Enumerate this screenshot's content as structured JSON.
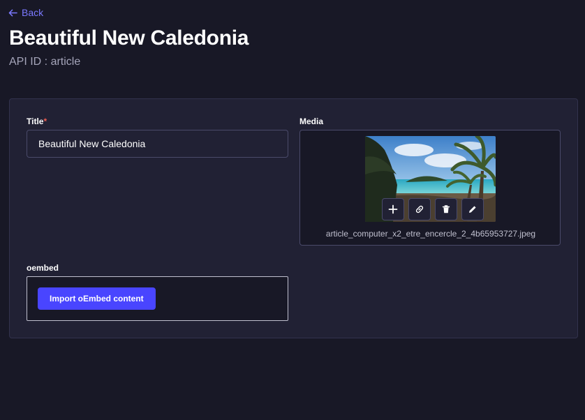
{
  "header": {
    "back_label": "Back",
    "title": "Beautiful New Caledonia",
    "subtitle": "API ID : article"
  },
  "form": {
    "title_field": {
      "label": "Title",
      "required_mark": "*",
      "value": "Beautiful New Caledonia"
    },
    "media_field": {
      "label": "Media",
      "filename": "article_computer_x2_etre_encercle_2_4b65953727.jpeg",
      "actions": [
        "plus-icon",
        "link-icon",
        "trash-icon",
        "pencil-icon"
      ]
    },
    "oembed_field": {
      "label": "oembed",
      "button_label": "Import oEmbed content"
    }
  },
  "colors": {
    "background": "#181826",
    "card": "#212134",
    "accent": "#4945ff",
    "link": "#7b79ff",
    "required": "#ee5e52"
  }
}
